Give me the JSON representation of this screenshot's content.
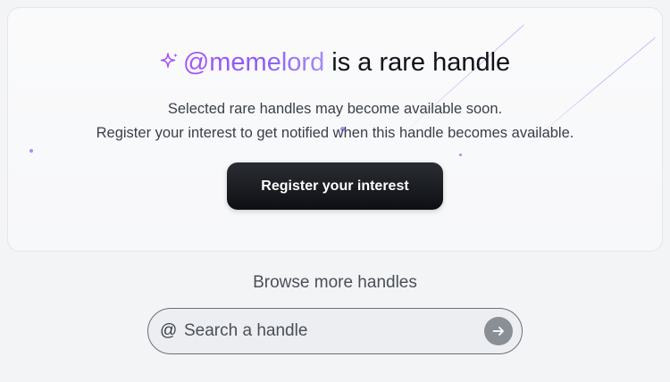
{
  "hero": {
    "handle": "@memelord",
    "title_suffix": " is a rare handle",
    "sparkle_icon": "sparkle-icon",
    "description_line1": "Selected rare handles may become available soon.",
    "description_line2": "Register your interest to get notified when this handle becomes available.",
    "cta_label": "Register your interest"
  },
  "browse": {
    "heading": "Browse more handles",
    "at_symbol": "@",
    "search_placeholder": "Search a handle",
    "submit_icon": "arrow-right-icon"
  },
  "colors": {
    "accent_purple": "#8b5cf6",
    "cta_background": "#16181d",
    "submit_button": "#8a8f96"
  }
}
